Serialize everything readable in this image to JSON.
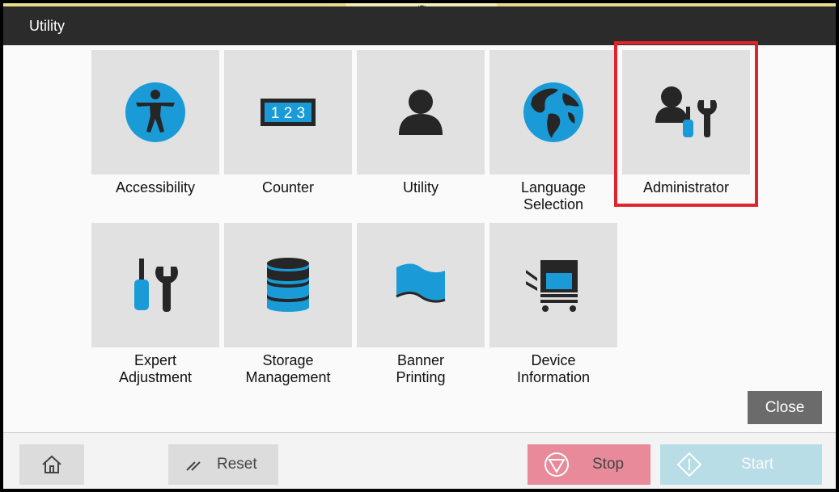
{
  "window": {
    "title": "Utility"
  },
  "tiles": [
    {
      "label": "Accessibility",
      "icon": "accessibility-icon"
    },
    {
      "label": "Counter",
      "icon": "counter-icon",
      "counter_text": "1 2 3"
    },
    {
      "label": "Utility",
      "icon": "user-icon"
    },
    {
      "label": "Language\nSelection",
      "icon": "globe-icon"
    },
    {
      "label": "Administrator",
      "icon": "admin-tools-icon",
      "highlighted": true
    },
    {
      "label": "Expert\nAdjustment",
      "icon": "tools-icon"
    },
    {
      "label": "Storage\nManagement",
      "icon": "database-icon"
    },
    {
      "label": "Banner\nPrinting",
      "icon": "banner-icon"
    },
    {
      "label": "Device\nInformation",
      "icon": "printer-icon"
    }
  ],
  "buttons": {
    "close": "Close",
    "reset": "Reset",
    "stop": "Stop",
    "start": "Start"
  },
  "colors": {
    "accent": "#1a9bd7",
    "dark": "#2b2b2b",
    "highlight": "#e0242b",
    "stop": "#e88a9a",
    "start": "#b8dde6"
  }
}
